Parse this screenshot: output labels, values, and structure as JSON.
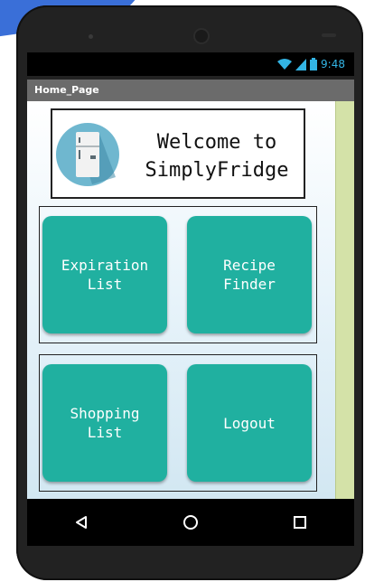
{
  "status_bar": {
    "time": "9:48",
    "icons": [
      "wifi-icon",
      "signal-icon",
      "battery-icon"
    ]
  },
  "app_bar": {
    "title": "Home_Page"
  },
  "welcome": {
    "icon": "fridge-icon",
    "line1": "Welcome to",
    "line2": "SimplyFridge"
  },
  "buttons": {
    "expiration": "Expiration\nList",
    "recipe": "Recipe\nFinder",
    "shopping": "Shopping\nList",
    "logout": "Logout"
  },
  "nav": {
    "icons": [
      "back-icon",
      "home-icon",
      "recents-icon"
    ]
  },
  "colors": {
    "accent": "#20b0a0",
    "status_text": "#33b5e5",
    "titlebar": "#6b6b6b"
  }
}
